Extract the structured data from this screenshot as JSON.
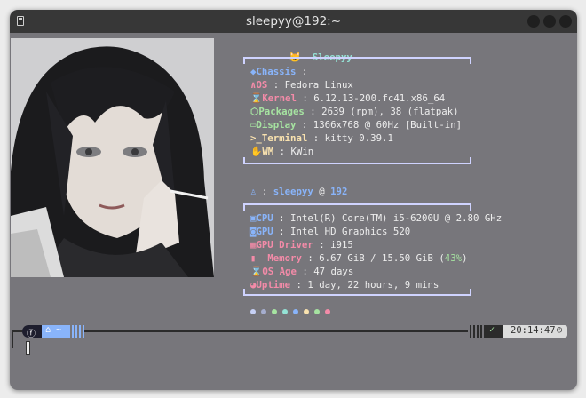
{
  "window": {
    "title": "sleepyy@192:~"
  },
  "header": {
    "user": "Sleepyy"
  },
  "system": [
    {
      "key": "Chassis",
      "sep": " :",
      "value": "",
      "color": "blue"
    },
    {
      "key": "OS",
      "sep": " :",
      "value": " Fedora Linux",
      "color": "red"
    },
    {
      "key": "Kernel",
      "sep": " :",
      "value": " 6.12.13-200.fc41.x86_64",
      "color": "red"
    },
    {
      "key": "Packages",
      "sep": " :",
      "value": " 2639 (rpm), 38 (flatpak)",
      "color": "green"
    },
    {
      "key": "Display",
      "sep": " :",
      "value": " 1366x768 @ 60Hz [Built-in]",
      "color": "green"
    },
    {
      "key": "Terminal",
      "sep": " :",
      "value": " kitty 0.39.1",
      "color": "yellow"
    },
    {
      "key": "WM",
      "sep": " :",
      "value": " KWin",
      "color": "yellow"
    }
  ],
  "userline": {
    "user": "sleepyy",
    "at": "@",
    "host": "192",
    "sep": ":"
  },
  "hardware": [
    {
      "key": "CPU",
      "sep": " :",
      "value": " Intel(R) Core(TM) i5-6200U @ 2.80 GHz",
      "color": "blue"
    },
    {
      "key": "GPU",
      "sep": " :",
      "value": " Intel HD Graphics 520",
      "color": "blue"
    },
    {
      "key": "GPU Driver",
      "sep": " :",
      "value": " i915",
      "color": "red"
    },
    {
      "key": "Memory",
      "sep": " :",
      "value": " 6.67 GiB / 15.50 GiB (",
      "pct": "43%",
      "tail": ")",
      "color": "red"
    },
    {
      "key": "OS Age",
      "sep": " :",
      "value": " 47 days",
      "color": "red"
    },
    {
      "key": "Uptime",
      "sep": " :",
      "value": " 1 day, 22 hours, 9 mins",
      "color": "red"
    }
  ],
  "palette": [
    "#c6d0f5",
    "#a5adce",
    "#a6e3a1",
    "#94e2d5",
    "#89b4fa",
    "#f9e2af",
    "#a6e3a1",
    "#f38ba8"
  ],
  "prompt": {
    "home": "~",
    "check": "✓",
    "time": "20:14:47"
  },
  "colors": {
    "background": "#77767b",
    "titlebar": "#373737",
    "frame": "#cfd3ff",
    "accent_blue": "#89b4fa",
    "accent_red": "#f38ba8",
    "accent_green": "#a6e3a1",
    "accent_yellow": "#f9e2af"
  }
}
